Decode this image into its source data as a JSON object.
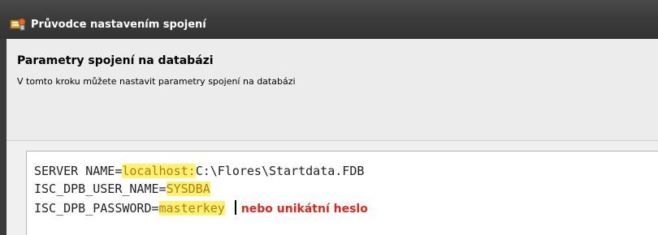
{
  "window": {
    "title": "Průvodce nastavením spojení",
    "icon": "wizard-app-icon"
  },
  "step": {
    "title": "Parametry spojení na databázi",
    "description": "V tomto kroku můžete nastavit parametry spojení na databázi"
  },
  "params": {
    "server_key": "SERVER NAME=",
    "server_host": "localhost:",
    "server_path": "C:\\Flores\\Startdata.FDB",
    "user_key": "ISC_DPB_USER_NAME=",
    "user_value": "SYSDBA",
    "password_key": "ISC_DPB_PASSWORD=",
    "password_value": "masterkey",
    "password_note": "nebo unikátní heslo"
  },
  "colors": {
    "highlight": "#fff176",
    "note": "#e0261b",
    "titlebar": "#3b3b3b"
  }
}
